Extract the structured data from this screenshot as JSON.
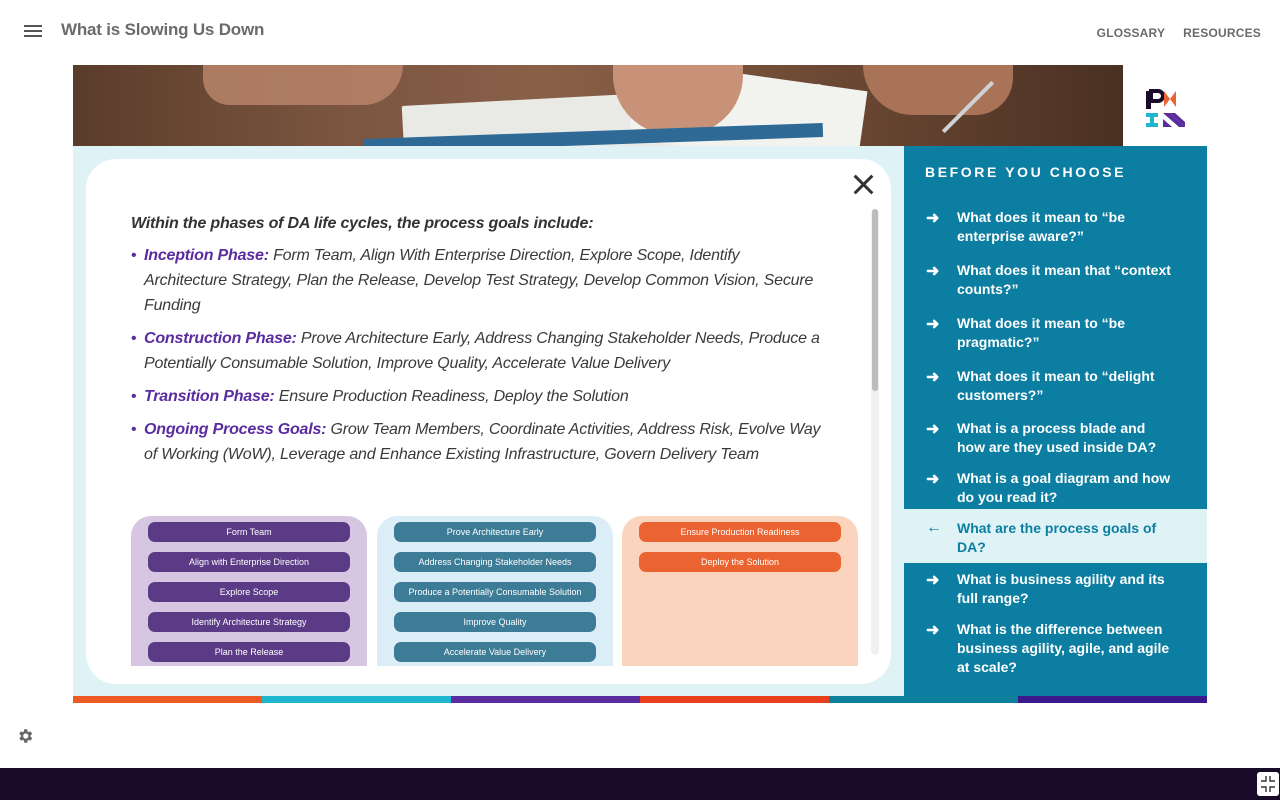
{
  "header": {
    "title": "What is Slowing Us Down",
    "links": [
      "GLOSSARY",
      "RESOURCES"
    ]
  },
  "modal": {
    "intro": "Within the phases of DA life cycles, the process goals include:",
    "goals": [
      {
        "phase": "Inception Phase:",
        "text": " Form Team, Align With Enterprise Direction, Explore Scope, Identify Architecture Strategy, Plan the Release, Develop Test Strategy, Develop Common Vision, Secure Funding"
      },
      {
        "phase": "Construction Phase:",
        "text": " Prove Architecture Early, Address Changing Stakeholder Needs, Produce a Potentially Consumable Solution, Improve Quality, Accelerate Value Delivery"
      },
      {
        "phase": "Transition Phase:",
        "text": " Ensure Production Readiness, Deploy the Solution"
      },
      {
        "phase": "Ongoing Process Goals:",
        "text": " Grow Team Members, Coordinate Activities, Address Risk, Evolve Way of Working (WoW), Leverage and Enhance Existing Infrastructure, Govern Delivery Team"
      }
    ],
    "diagram": {
      "inception": [
        "Form Team",
        "Align with Enterprise Direction",
        "Explore Scope",
        "Identify Architecture Strategy",
        "Plan the Release"
      ],
      "construction": [
        "Prove Architecture Early",
        "Address Changing Stakeholder Needs",
        "Produce a Potentially Consumable Solution",
        "Improve Quality",
        "Accelerate Value Delivery"
      ],
      "transition": [
        "Ensure Production Readiness",
        "Deploy the Solution"
      ]
    }
  },
  "sidebar": {
    "heading": "BEFORE YOU CHOOSE",
    "items": [
      {
        "label": "What does it mean to “be enterprise aware?”",
        "icon": "arrow-right-icon",
        "active": false
      },
      {
        "label": "What does it mean that “context counts?”",
        "icon": "arrow-right-icon",
        "active": false
      },
      {
        "label": "What does it mean to “be pragmatic?”",
        "icon": "arrow-right-icon",
        "active": false
      },
      {
        "label": "What does it mean to “delight customers?”",
        "icon": "arrow-right-icon",
        "active": false
      },
      {
        "label": "What is a process blade and how are they used inside DA?",
        "icon": "arrow-right-icon",
        "active": false
      },
      {
        "label": "What is a goal diagram and how do you read it?",
        "icon": "arrow-right-icon",
        "active": false
      },
      {
        "label": "What are the process goals of DA?",
        "icon": "arrow-left-icon",
        "active": true
      },
      {
        "label": "What is business agility and its full range?",
        "icon": "arrow-right-icon",
        "active": false
      },
      {
        "label": "What is the difference between business agility, agile, and agile  at scale?",
        "icon": "arrow-right-icon",
        "active": false
      }
    ]
  },
  "colors": {
    "brand_teal": "#0c7ea1",
    "phase_purple": "#5a2ca0",
    "stripe": [
      "#ee5a24",
      "#1fb6d0",
      "#5a2ca0",
      "#e8401c",
      "#0f7f9e",
      "#3a1a8a"
    ]
  }
}
